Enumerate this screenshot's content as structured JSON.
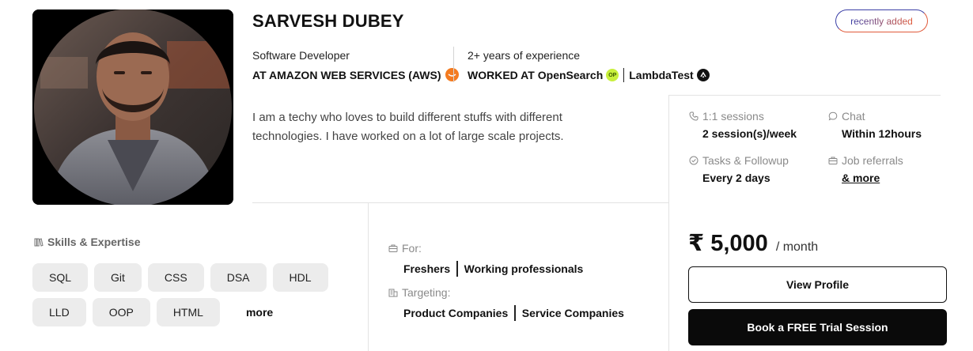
{
  "profile": {
    "name": "SARVESH DUBEY",
    "badge": "recently added",
    "role_title": "Software Developer",
    "role_company": "AT AMAZON WEB SERVICES (AWS)",
    "experience": "2+ years of experience",
    "worked_at_prefix": "WORKED AT",
    "past_companies": [
      "OpenSearch",
      "LambdaTest"
    ],
    "company_logos": {
      "aws": "aws-logo-icon",
      "opensearch": "opensearch-logo-icon",
      "opensearch_text": "OP",
      "lambdatest": "lambdatest-logo-icon"
    },
    "bio": "I am a techy who loves to build different stuffs with different technologies. I have worked on a lot of large scale projects."
  },
  "features": {
    "sessions": {
      "label": "1:1 sessions",
      "value": "2 session(s)/week",
      "icon": "phone-icon"
    },
    "chat": {
      "label": "Chat",
      "value": "Within 12hours",
      "icon": "chat-bubble-icon"
    },
    "tasks": {
      "label": "Tasks & Followup",
      "value": "Every 2 days",
      "icon": "check-circle-icon"
    },
    "referrals": {
      "label": "Job referrals",
      "value": "& more",
      "icon": "briefcase-icon"
    }
  },
  "skills": {
    "title": "Skills & Expertise",
    "icon": "books-icon",
    "items": [
      "SQL",
      "Git",
      "CSS",
      "DSA",
      "HDL",
      "LLD",
      "OOP",
      "HTML"
    ],
    "more_label": "more"
  },
  "audience": {
    "for_label": "For:",
    "for_values": [
      "Freshers",
      "Working professionals"
    ],
    "for_icon": "briefcase-icon",
    "targeting_label": "Targeting:",
    "targeting_values": [
      "Product Companies",
      "Service Companies"
    ],
    "targeting_icon": "building-icon"
  },
  "pricing": {
    "amount": "₹ 5,000",
    "period": "/ month"
  },
  "actions": {
    "view_profile": "View Profile",
    "book_trial": "Book a FREE Trial Session"
  },
  "colors": {
    "badge_start": "#3b3fa6",
    "badge_end": "#e05a3a",
    "aws_logo": "#f47b20",
    "opensearch_logo": "#c8f03c",
    "primary_button": "#0a0a0a",
    "chip_bg": "#ececec"
  }
}
